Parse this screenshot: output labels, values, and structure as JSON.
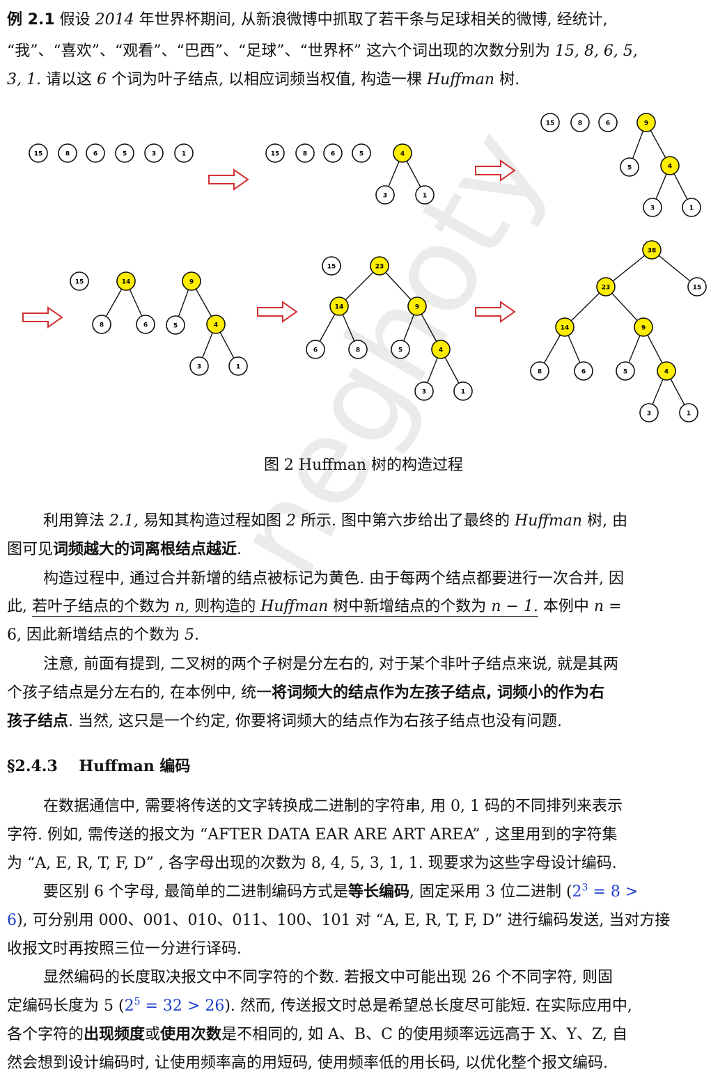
{
  "watermark": "neghoty",
  "example": {
    "label": "例 2.1",
    "l1a": "假设",
    "year": "2014",
    "l1b": "年世界杯期间, 从新浪微博中抓取了若干条与足球相关的微博, 经统计,",
    "l2a": "“我”、“喜欢”、“观看”、“巴西”、“足球”、“世界杯” 这六个词出现的次数分别为",
    "l2b": "15, 8, 6, 5,",
    "l3a": "3, 1.",
    "l3b": "请以这",
    "l3c": "6",
    "l3d": "个词为叶子结点, 以相应词频当权值, 构造一棵",
    "l3e": "Huffman",
    "l3f": "树."
  },
  "figure": {
    "caption": "图 2   Huffman 树的构造过程",
    "arrow_color": "#d23030",
    "new_node_color": "#ffee00",
    "step1": [
      "15",
      "8",
      "6",
      "5",
      "3",
      "1"
    ],
    "step2": [
      "15",
      "8",
      "6",
      "5",
      "4",
      "3",
      "1"
    ],
    "step3": [
      "15",
      "8",
      "6",
      "9",
      "5",
      "4",
      "3",
      "1"
    ],
    "step4": [
      "15",
      "14",
      "8",
      "6",
      "9",
      "5",
      "4",
      "3",
      "1"
    ],
    "step5": [
      "15",
      "23",
      "14",
      "8",
      "6",
      "9",
      "5",
      "4",
      "3",
      "1"
    ],
    "step6": [
      "38",
      "23",
      "15",
      "14",
      "9",
      "8",
      "6",
      "5",
      "4",
      "3",
      "1"
    ]
  },
  "para1": {
    "a": "利用算法",
    "b": "2.1,",
    "c": "易知其构造过程如图",
    "d": "2",
    "e": "所示. 图中第六步给出了最终的",
    "f": "Huffman",
    "g": "树, 由",
    "h": "图可见",
    "i": "词频越大的词离根结点越近",
    "j": "."
  },
  "para2": {
    "a": "构造过程中, 通过合并新增的结点被标记为黄色. 由于每两个结点都要进行一次合并, 因",
    "b": "此,",
    "c": "若叶子结点的个数为",
    "d": "n,",
    "e": "则构造的",
    "f": "Huffman",
    "g": "树中新增结点的个数为",
    "h": "n − 1.",
    "i": "本例中",
    "j": "n =",
    "k": "6,",
    "l": "因此新增结点的个数为",
    "m": "5."
  },
  "para3": {
    "a": "注意, 前面有提到, 二叉树的两个子树是分左右的, 对于某个非叶子结点来说, 就是其两",
    "b": "个孩子结点是分左右的, 在本例中, 统一",
    "c": "将词频大的结点作为左孩子结点, 词频小的作为右",
    "d": "孩子结点",
    "e": ". 当然, 这只是一个约定, 你要将词频大的结点作为右孩子结点也没有问题."
  },
  "section": {
    "num": "§2.4.3",
    "title": "Huffman 编码"
  },
  "para4": {
    "a": "在数据通信中, 需要将传送的文字转换成二进制的字符串, 用 0, 1 码的不同排列来表示",
    "b": "字符. 例如, 需传送的报文为 “AFTER DATA EAR ARE ART AREA” , 这里用到的字符集",
    "c": "为 “A, E, R, T, F, D” , 各字母出现的次数为 8, 4, 5, 3, 1, 1. 现要求为这些字母设计编码."
  },
  "para5": {
    "a": "要区别 6 个字母, 最简单的二进制编码方式是",
    "b": "等长编码",
    "c": ", 固定采用 3 位二进制 (",
    "d": "2",
    "e": "3",
    "f": " = 8 >",
    "g": "6",
    "h": "), 可分别用 000、001、010、011、100、101 对 “A, E, R, T, F, D” 进行编码发送, 当对方接",
    "i": "收报文时再按照三位一分进行译码."
  },
  "para6": {
    "a": "显然编码的长度取决报文中不同字符的个数. 若报文中可能出现 26 个不同字符, 则固",
    "b": "定编码长度为 5 (",
    "c": "2",
    "d": "5",
    "e": " = 32 > 26",
    "f": "). 然而, 传送报文时总是希望总长度尽可能短. 在实际应用中,",
    "g": "各个字符的",
    "h": "出现频度",
    "i": "或",
    "j": "使用次数",
    "k": "是不相同的, 如 A、B、C 的使用频率远远高于 X、Y、Z, 自",
    "l": "然会想到设计编码时, 让使用频率高的用短码, 使用频率低的用长码, 以优化整个报文编码."
  }
}
